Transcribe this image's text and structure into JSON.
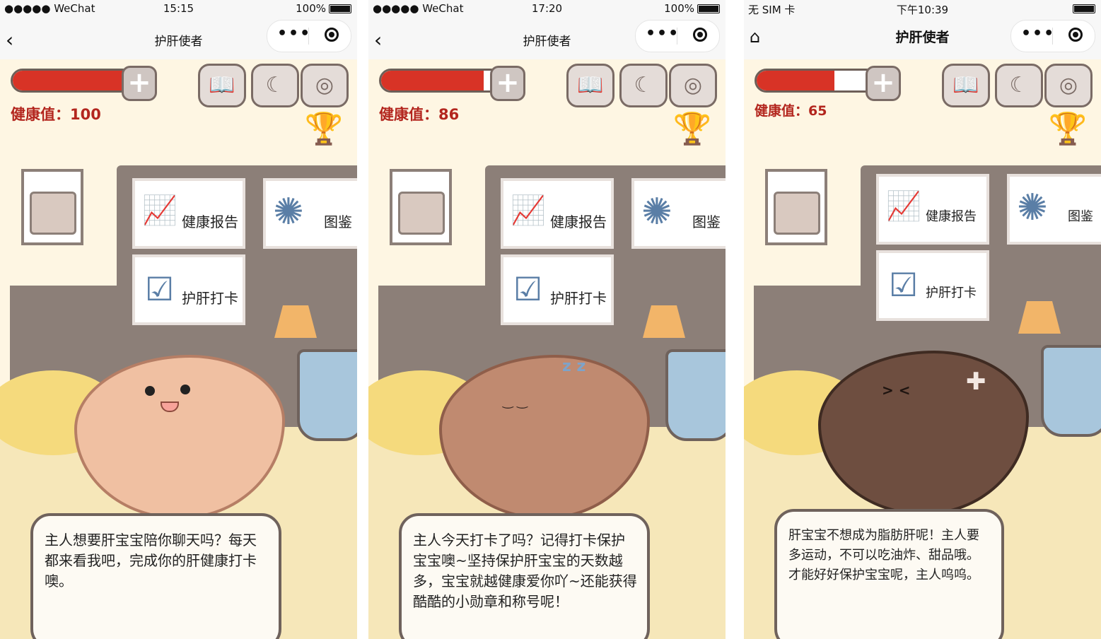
{
  "colors": {
    "health_red": "#d83326",
    "text_red": "#b3261e",
    "outline": "#6f625c"
  },
  "screens": [
    {
      "status": {
        "left": "●●●●● WeChat",
        "time": "15:15",
        "battery": "100%"
      },
      "nav_title": "护肝使者",
      "nav_left_icon": "back-chevron-icon",
      "health_label": "健康值：100",
      "health_value": 100,
      "cards": {
        "report": "健康报告",
        "gallery": "图鉴",
        "checkin": "护肝打卡"
      },
      "liver_mood": "happy",
      "bubble_text": "主人想要肝宝宝陪你聊天吗？每天都来看我吧，完成你的肝健康打卡噢。"
    },
    {
      "status": {
        "left": "●●●●● WeChat",
        "time": "17:20",
        "battery": "100%"
      },
      "nav_title": "护肝使者",
      "nav_left_icon": "back-chevron-icon",
      "health_label": "健康值：86",
      "health_value": 86,
      "cards": {
        "report": "健康报告",
        "gallery": "图鉴",
        "checkin": "护肝打卡"
      },
      "liver_mood": "sleepy",
      "bubble_text": "主人今天打卡了吗？记得打卡保护宝宝噢~坚持保护肝宝宝的天数越多，宝宝就越健康爱你吖~还能获得酷酷的小勋章和称号呢！"
    },
    {
      "status": {
        "left": "无 SIM 卡",
        "time": "下午10:39",
        "battery": ""
      },
      "nav_title": "护肝使者",
      "nav_left_icon": "home-icon",
      "health_label": "健康值：65",
      "health_value": 65,
      "cards": {
        "report": "健康报告",
        "gallery": "图鉴",
        "checkin": "护肝打卡"
      },
      "liver_mood": "hurt",
      "bubble_text": "肝宝宝不想成为脂肪肝呢！主人要多运动，不可以吃油炸、甜品哦。才能好好保护宝宝呢，主人呜呜。"
    }
  ]
}
